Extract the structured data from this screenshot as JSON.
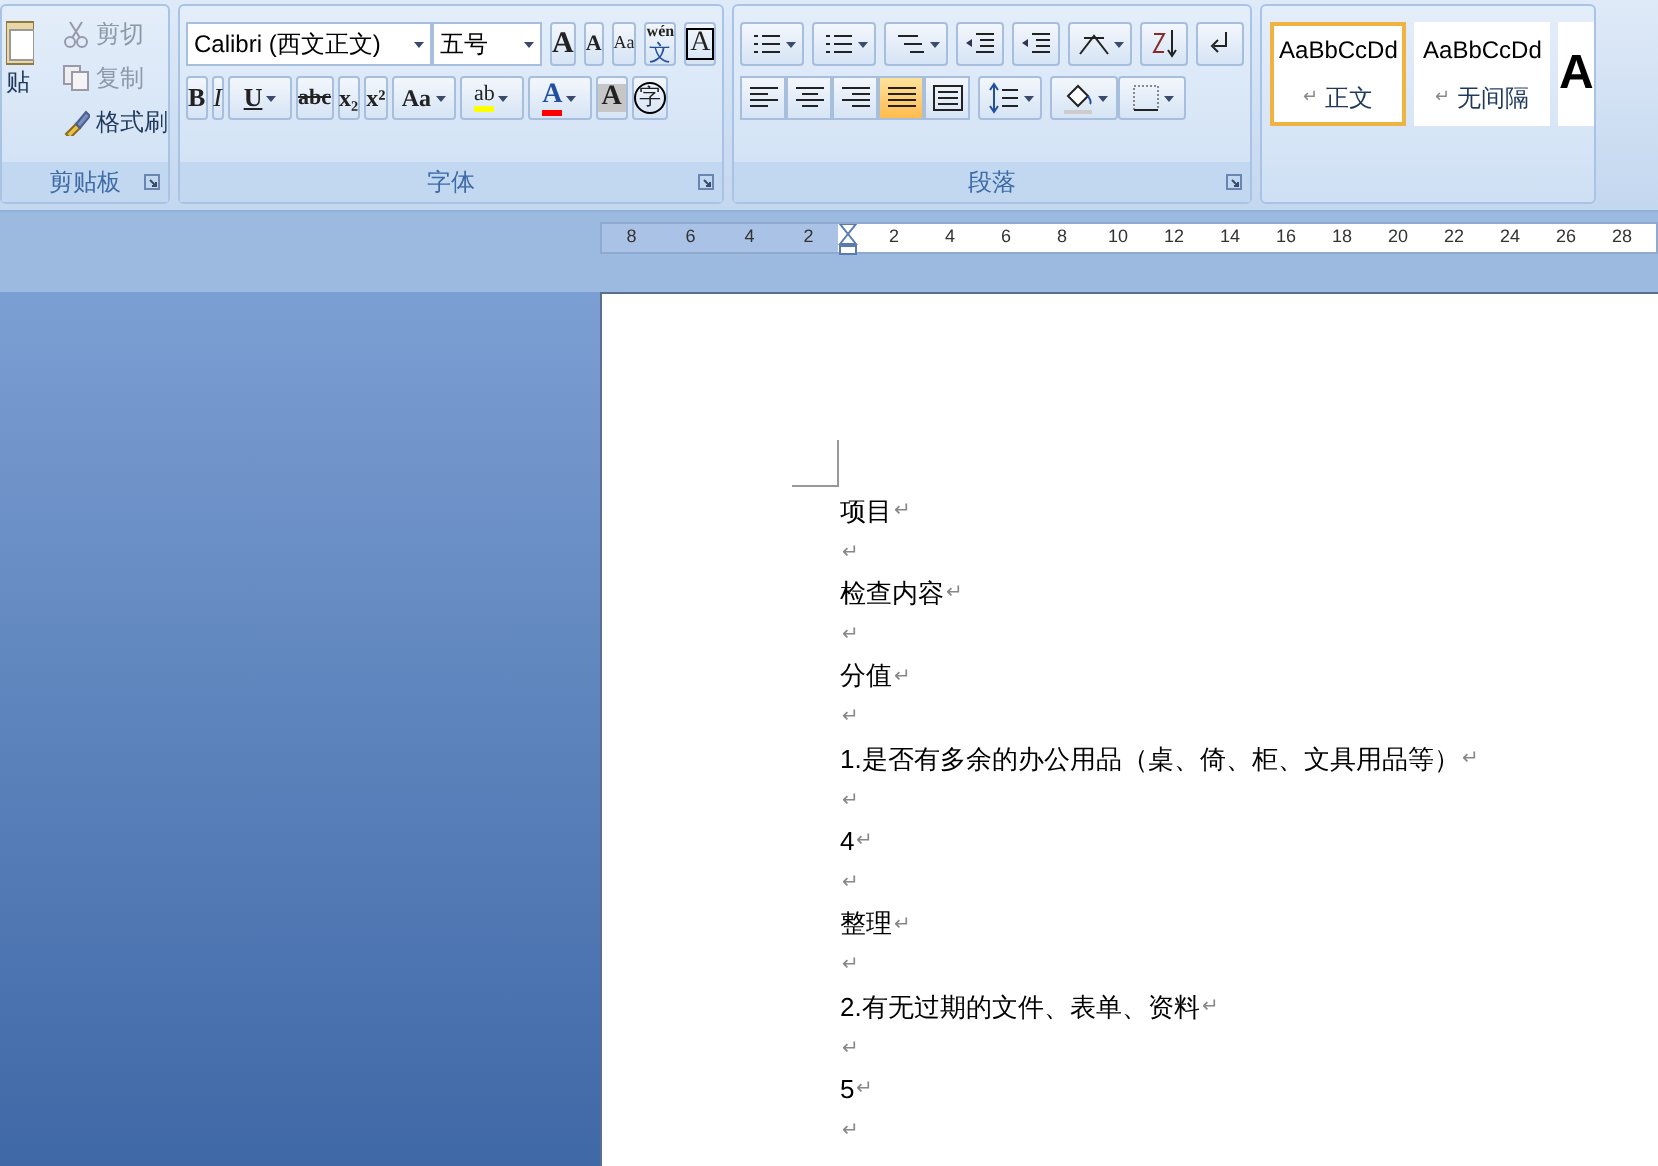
{
  "ribbon": {
    "groups": [
      {
        "kind": "clipboard",
        "label": "剪贴板",
        "paste": "贴",
        "actions": [
          {
            "label": "剪切",
            "disabled": true
          },
          {
            "label": "复制",
            "disabled": true
          },
          {
            "label": "格式刷",
            "disabled": false
          }
        ]
      },
      {
        "kind": "font",
        "label": "字体",
        "font_name": "Calibri (西文正文)",
        "font_size": "五号",
        "row1": [
          {
            "glyph": "A"
          },
          {
            "glyph": "A"
          },
          {
            "glyph": "Aa"
          },
          {
            "glyph": "wén",
            "sub": "文"
          },
          {
            "glyph": "A"
          }
        ],
        "row2": [
          {
            "glyph": "B"
          },
          {
            "glyph": "I"
          },
          {
            "glyph": "U"
          },
          {
            "glyph": "abc"
          },
          {
            "glyph": "x₂"
          },
          {
            "glyph": "x²"
          },
          {
            "glyph": "Aa"
          },
          {
            "glyph": "ab"
          },
          {
            "glyph": "A"
          },
          {
            "glyph": "A"
          },
          {
            "glyph": "字"
          }
        ]
      },
      {
        "kind": "paragraph",
        "label": "段落",
        "align": [
          {
            "selected": false
          },
          {
            "selected": false
          },
          {
            "selected": false
          },
          {
            "selected": true
          },
          {
            "selected": false
          }
        ]
      },
      {
        "kind": "styles",
        "styles": [
          {
            "preview": "AaBbCcDd",
            "mark": "↵",
            "name": "正文",
            "selected": true
          },
          {
            "preview": "AaBbCcDd",
            "mark": "↵",
            "name": "无间隔",
            "selected": false
          },
          {
            "preview": "A",
            "selected": false
          }
        ]
      }
    ]
  },
  "ruler": {
    "left_ticks": [
      "8",
      "6",
      "4",
      "2"
    ],
    "right_ticks": [
      "2",
      "4",
      "6",
      "8",
      "10",
      "12",
      "14",
      "16",
      "18",
      "20",
      "22",
      "24",
      "26",
      "28"
    ]
  },
  "document": {
    "paragraphs": [
      {
        "text": "项目",
        "mark": "↵"
      },
      {
        "mark": "↵"
      },
      {
        "text": "检查内容",
        "mark": "↵"
      },
      {
        "mark": "↵"
      },
      {
        "text": "分值",
        "mark": "↵"
      },
      {
        "mark": "↵"
      },
      {
        "text": "1.是否有多余的办公用品（桌、倚、柜、文具用品等）",
        "mark": "↵"
      },
      {
        "mark": "↵"
      },
      {
        "text": "4",
        "mark": "↵"
      },
      {
        "mark": "↵"
      },
      {
        "text": "整理",
        "mark": "↵"
      },
      {
        "mark": "↵"
      },
      {
        "text": "2.有无过期的文件、表单、资料",
        "mark": "↵"
      },
      {
        "mark": "↵"
      },
      {
        "text": "5",
        "mark": "↵"
      },
      {
        "mark": "↵"
      }
    ]
  }
}
